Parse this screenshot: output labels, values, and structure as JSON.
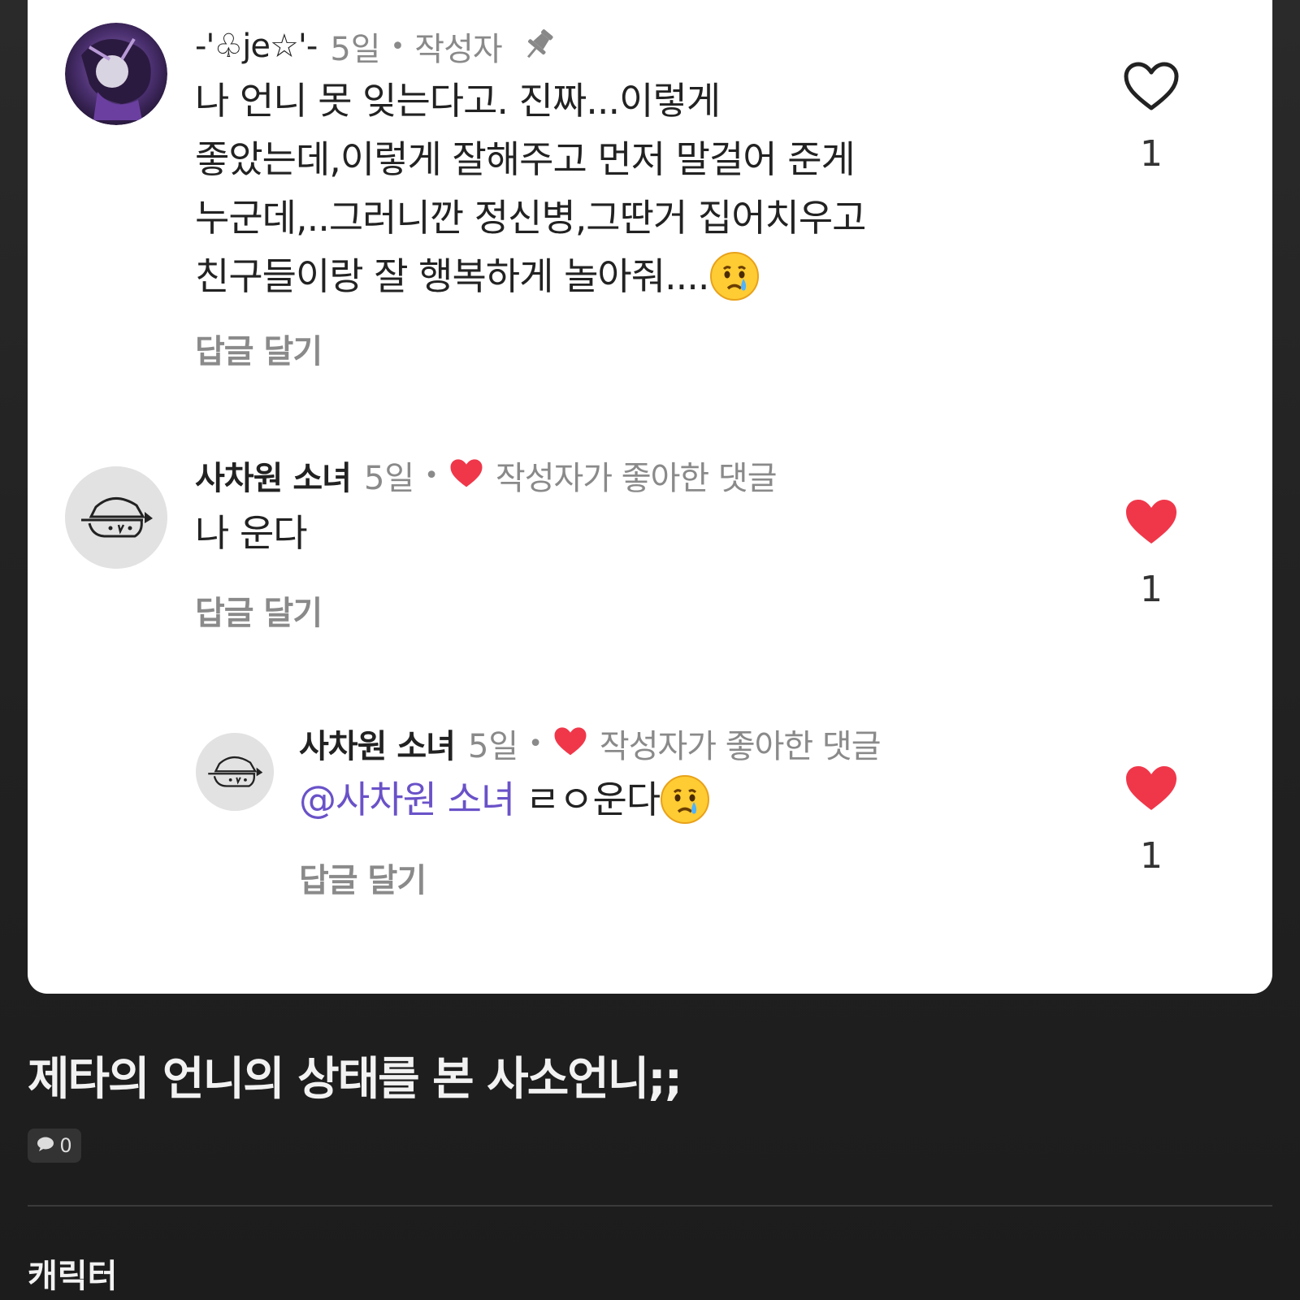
{
  "comments": [
    {
      "author": "-'♧je☆'-",
      "time": "5일",
      "dot": "•",
      "badge": "작성자",
      "lines": [
        "나 언니 못 잊는다고. 진짜...이렇게",
        "좋았는데,이렇게 잘해주고 먼저 말걸어 준게",
        "누군데,..그러니깐 정신병,그딴거 집어치우고",
        "친구들이랑 잘 행복하게 놀아줘...."
      ],
      "reply_label": "답글 달기",
      "like_count": "1",
      "liked": false,
      "icons": [
        "pin-icon",
        "crying-face-emoji",
        "heart-outline-icon"
      ]
    },
    {
      "author": "사차원 소녀",
      "time": "5일",
      "dot": "•",
      "badge": "작성자가 좋아한 댓글",
      "text": "나 운다",
      "reply_label": "답글 달기",
      "like_count": "1",
      "liked": true,
      "icons": [
        "heart-icon"
      ]
    },
    {
      "author": "사차원 소녀",
      "time": "5일",
      "dot": "•",
      "badge": "작성자가 좋아한 댓글",
      "mention": "@사차원 소녀",
      "text": " ㄹㅇ운다",
      "reply_label": "답글 달기",
      "like_count": "1",
      "liked": true,
      "icons": [
        "heart-icon",
        "crying-face-emoji"
      ]
    }
  ],
  "post": {
    "title": "제타의 언니의 상태를 본 사소언니;;",
    "comment_count": "0",
    "comment_icon": "speech-bubble-icon"
  },
  "section": {
    "title": "캐릭터"
  },
  "colors": {
    "heart": "#f0374a",
    "mention": "#6a52c8",
    "muted": "#8a8a8a"
  }
}
